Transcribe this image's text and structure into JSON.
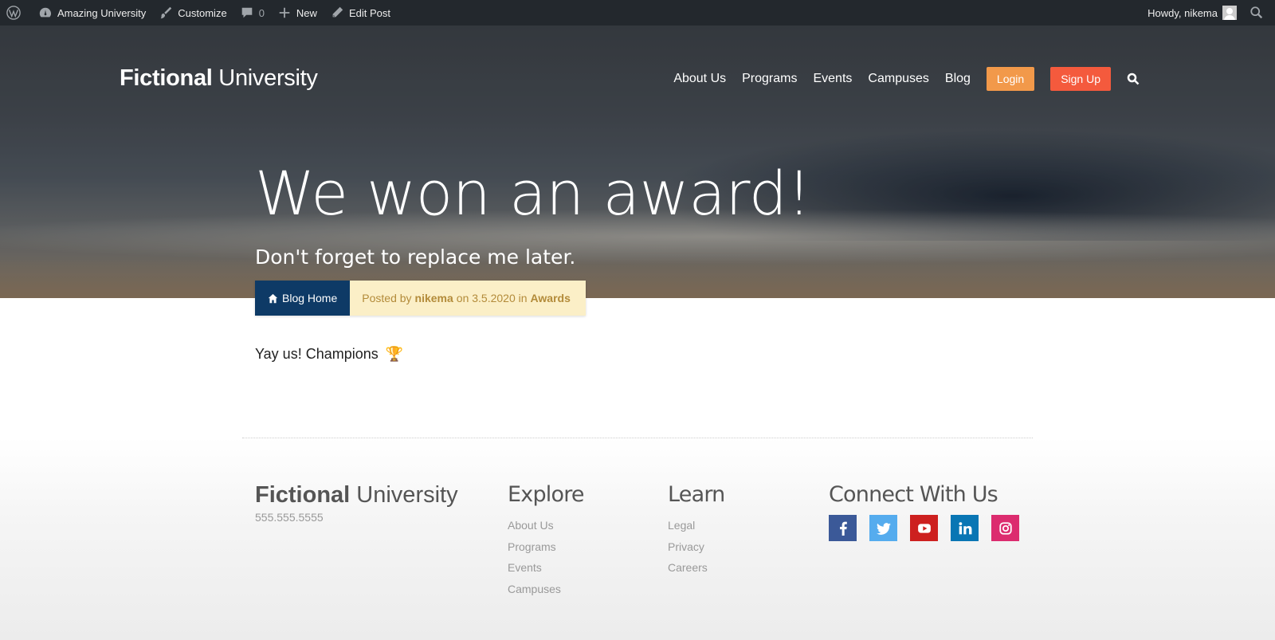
{
  "admin_bar": {
    "site_name": "Amazing University",
    "customize": "Customize",
    "comments_count": "0",
    "new": "New",
    "edit_post": "Edit Post",
    "howdy": "Howdy, nikema"
  },
  "header": {
    "brand_bold": "Fictional",
    "brand_light": "University",
    "nav": [
      "About Us",
      "Programs",
      "Events",
      "Campuses",
      "Blog"
    ],
    "login": "Login",
    "signup": "Sign Up"
  },
  "hero": {
    "title": "We won an award!",
    "subtitle": "Don't forget to replace me later."
  },
  "post": {
    "blog_home": "Blog Home",
    "posted_by": "Posted by",
    "author": "nikema",
    "on": "on 3.5.2020 in",
    "category": "Awards",
    "body": "Yay us! Champions",
    "trophy": "🏆"
  },
  "footer": {
    "brand_bold": "Fictional",
    "brand_light": "University",
    "phone": "555.555.5555",
    "explore_title": "Explore",
    "explore_links": [
      "About Us",
      "Programs",
      "Events",
      "Campuses"
    ],
    "learn_title": "Learn",
    "learn_links": [
      "Legal",
      "Privacy",
      "Careers"
    ],
    "connect_title": "Connect With Us",
    "socials": [
      "facebook",
      "twitter",
      "youtube",
      "linkedin",
      "instagram"
    ]
  },
  "colors": {
    "admin_bar": "#23282d",
    "login": "#f2994a",
    "signup": "#f45a3d",
    "blog_home": "#0e3a66",
    "meta_bg": "#fbefc7",
    "meta_text": "#b38b3a"
  }
}
